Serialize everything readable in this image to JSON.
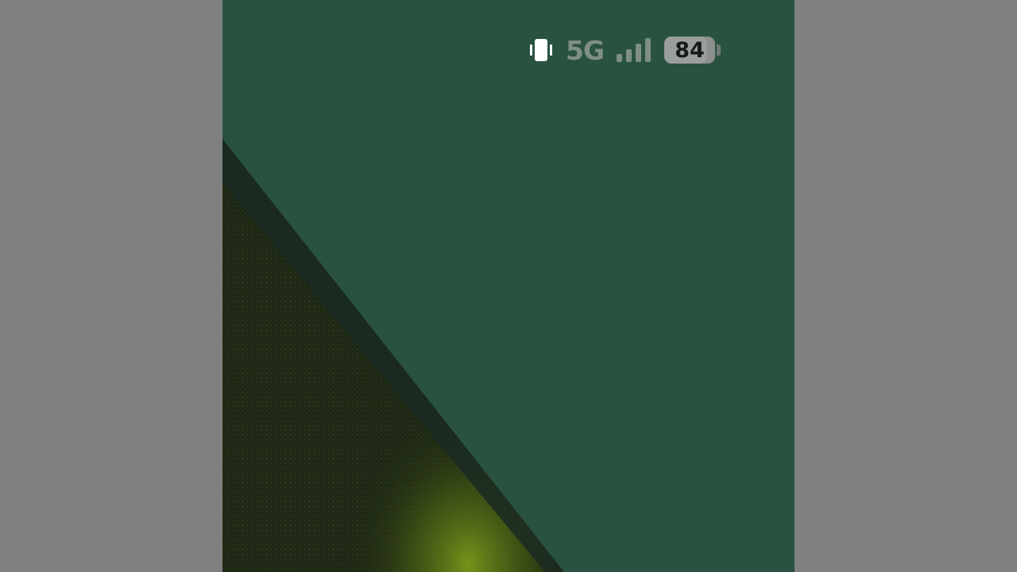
{
  "status_bar": {
    "ringer_mode_icon": "vibrate-icon",
    "network_type": "5G",
    "signal_icon": "cellular-signal-icon",
    "signal_bars": 4,
    "battery_icon": "battery-icon",
    "battery_level": "84",
    "battery_fraction": 0.84
  },
  "colors": {
    "letterbox": "#808080",
    "wallpaper_sky": "#2a5241",
    "wallpaper_ground": "#1f2a14",
    "ground_highlight": "#6e8a1a",
    "status_text": "#7e8f86",
    "battery_body": "#8b908d"
  }
}
